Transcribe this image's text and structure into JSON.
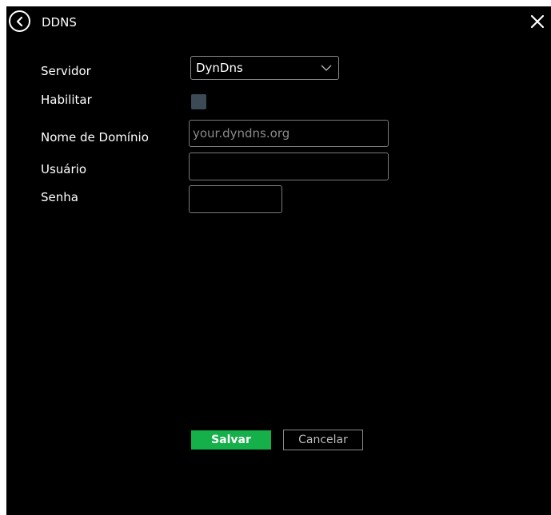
{
  "dialog": {
    "title": "DDNS",
    "back_icon": "back-circle-icon",
    "close_icon": "close-icon"
  },
  "form": {
    "server": {
      "label": "Servidor",
      "value": "DynDns"
    },
    "enable": {
      "label": "Habilitar",
      "checked": false
    },
    "domain": {
      "label": "Nome de Domínio",
      "placeholder": "your.dyndns.org",
      "value": ""
    },
    "user": {
      "label": "Usuário",
      "value": ""
    },
    "password": {
      "label": "Senha",
      "value": ""
    }
  },
  "actions": {
    "save_label": "Salvar",
    "cancel_label": "Cancelar"
  },
  "colors": {
    "background": "#000000",
    "save_button": "#16b04a",
    "checkbox": "#3c4a55",
    "field_border": "#7a7a7a"
  }
}
